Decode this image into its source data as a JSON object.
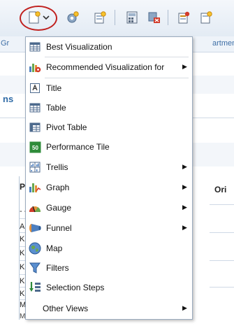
{
  "toolbar": {
    "buttons": [
      {
        "name": "new-view-icon",
        "interactable": true
      },
      {
        "name": "new-view-dropdown-chevron-icon",
        "interactable": true
      },
      {
        "name": "cog-add-icon",
        "interactable": true
      },
      {
        "name": "edit-view-icon",
        "interactable": true
      },
      {
        "name": "calculator-icon",
        "interactable": true
      },
      {
        "name": "remove-icon",
        "interactable": true
      },
      {
        "name": "properties-icon",
        "interactable": true
      },
      {
        "name": "export-icon",
        "interactable": true
      }
    ]
  },
  "background": {
    "gr_text": "Gr",
    "artmen_text": "artmen",
    "ns_text": "ns",
    "column_header_left": "Pr",
    "column_header_right": "Ori",
    "row_cells": [
      "- -",
      "AC",
      "K:",
      "K:",
      "K:",
      "K:",
      "K:",
      "MC"
    ],
    "bottom_row_text": "MO ... ..."
  },
  "menu": {
    "items": [
      {
        "label": "Best Visualization",
        "icon": "table-grid-icon",
        "submenu": false
      },
      {
        "label": "Recommended Visualization for",
        "icon": "recommended-chart-icon",
        "submenu": true
      },
      {
        "label": "Title",
        "icon": "title-icon",
        "submenu": false
      },
      {
        "label": "Table",
        "icon": "table-icon",
        "submenu": false
      },
      {
        "label": "Pivot Table",
        "icon": "pivot-table-icon",
        "submenu": false
      },
      {
        "label": "Performance Tile",
        "icon": "performance-tile-icon",
        "submenu": false
      },
      {
        "label": "Trellis",
        "icon": "trellis-icon",
        "submenu": true
      },
      {
        "label": "Graph",
        "icon": "graph-icon",
        "submenu": true
      },
      {
        "label": "Gauge",
        "icon": "gauge-icon",
        "submenu": true
      },
      {
        "label": "Funnel",
        "icon": "funnel-icon",
        "submenu": true
      },
      {
        "label": "Map",
        "icon": "map-globe-icon",
        "submenu": false
      },
      {
        "label": "Filters",
        "icon": "filter-icon",
        "submenu": false
      },
      {
        "label": "Selection Steps",
        "icon": "selection-steps-icon",
        "submenu": false
      },
      {
        "label": "Other Views",
        "icon": "",
        "submenu": true
      }
    ],
    "performance_tile_glyph": "50",
    "submenu_arrow": "▶"
  },
  "colors": {
    "highlight_circle": "#c0211f",
    "link_blue": "#3f6fa6",
    "menu_border": "#9aaabd"
  }
}
